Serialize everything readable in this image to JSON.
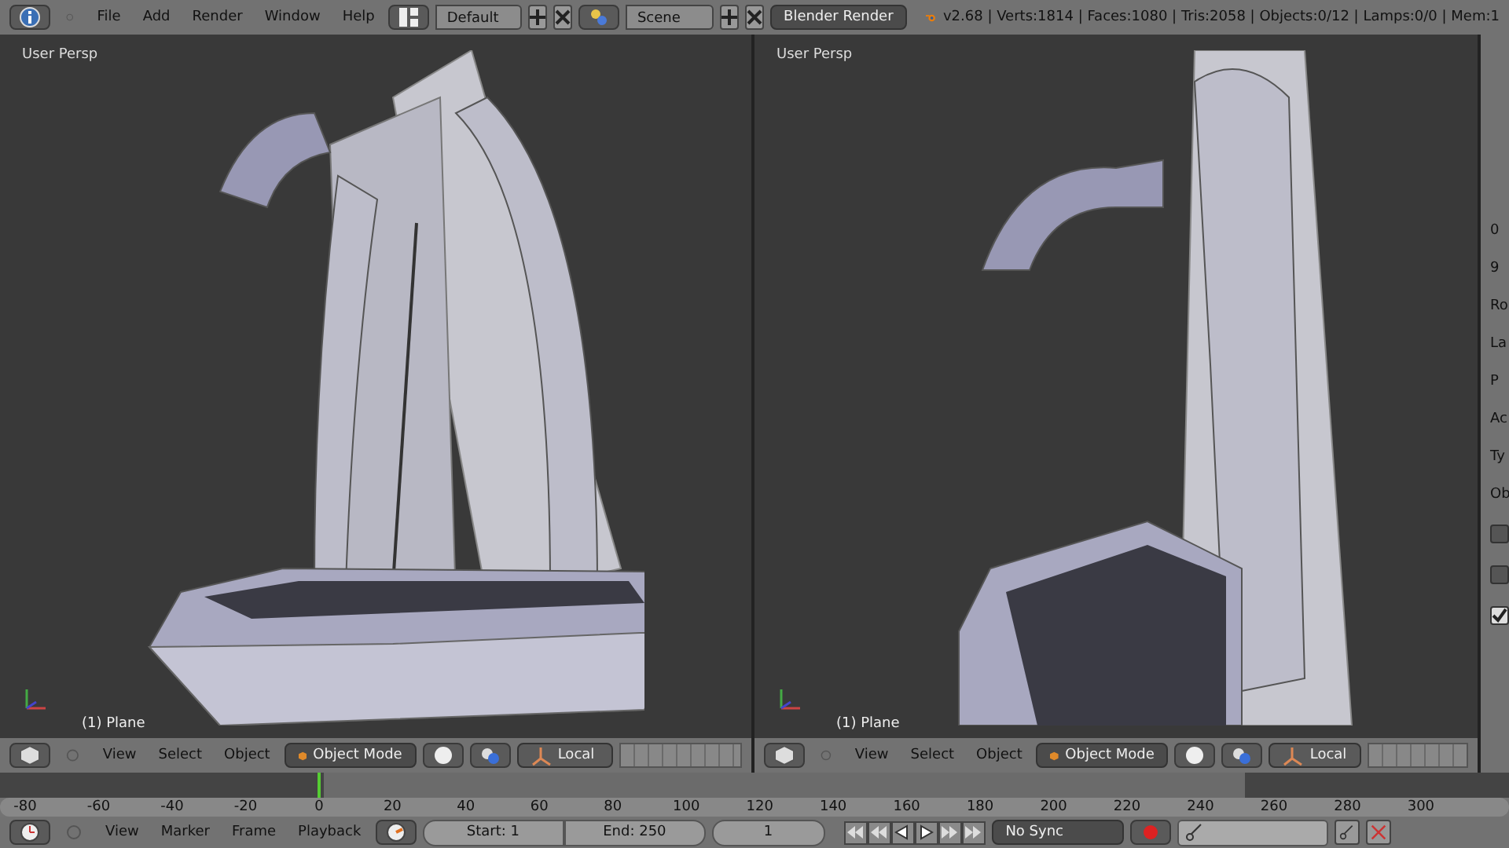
{
  "top_bar": {
    "menus": [
      "File",
      "Add",
      "Render",
      "Window",
      "Help"
    ],
    "layout": "Default",
    "scene": "Scene",
    "engine": "Blender Render",
    "stats": "v2.68 | Verts:1814 | Faces:1080 | Tris:2058 | Objects:0/12 | Lamps:0/0 | Mem:1"
  },
  "viewports": [
    {
      "kind": "front",
      "label": "User Persp",
      "object": "(1) Plane",
      "menus": [
        "View",
        "Select",
        "Object"
      ],
      "mode": "Object Mode",
      "orientation": "Local"
    },
    {
      "kind": "side",
      "label": "User Persp",
      "object": "(1) Plane",
      "menus": [
        "View",
        "Select",
        "Object"
      ],
      "mode": "Object Mode",
      "orientation": "Local"
    }
  ],
  "properties_panel": {
    "texts": [
      "0",
      "9",
      "Ro",
      "La",
      "P",
      "Ac",
      "Ty",
      "Ob"
    ],
    "checkboxes": [
      {
        "checked": false
      },
      {
        "checked": false
      },
      {
        "checked": true
      }
    ]
  },
  "timeline": {
    "ticks": [
      "-80",
      "-60",
      "-40",
      "-20",
      "0",
      "20",
      "40",
      "60",
      "80",
      "100",
      "120",
      "140",
      "160",
      "180",
      "200",
      "220",
      "240",
      "260",
      "280",
      "300"
    ],
    "playhead": {
      "level": 0.21
    },
    "menus": [
      "View",
      "Marker",
      "Frame",
      "Playback"
    ],
    "start": "Start: 1",
    "end": "End: 250",
    "frame": "1",
    "sync": "No Sync"
  }
}
